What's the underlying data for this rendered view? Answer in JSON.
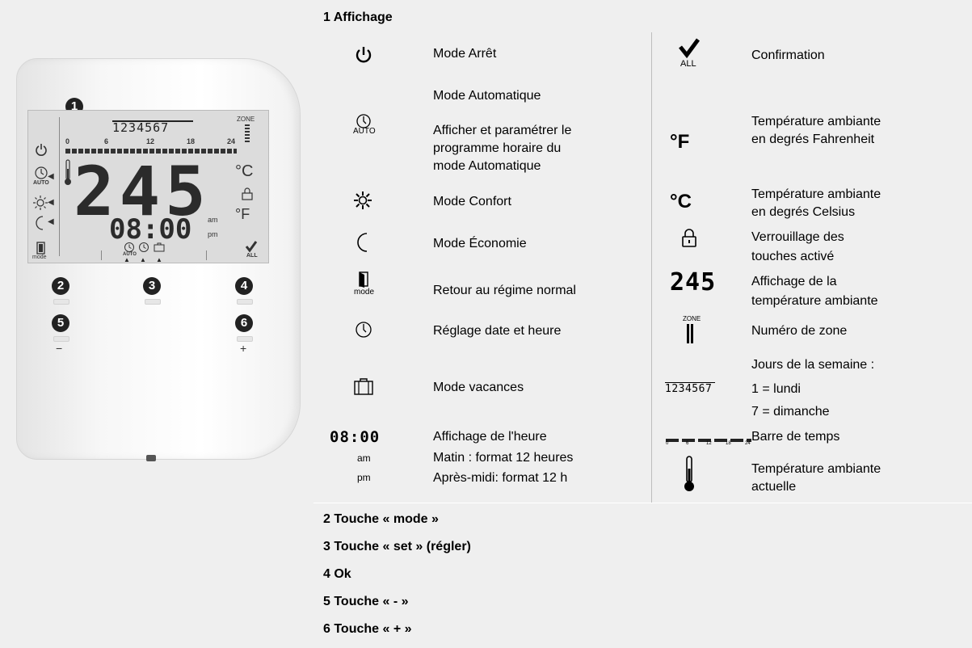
{
  "device": {
    "callouts": [
      "1",
      "2",
      "3",
      "4",
      "5",
      "6"
    ],
    "lcd": {
      "days": "1234567",
      "zone": "ZONE",
      "timescale": [
        "0",
        "6",
        "12",
        "18",
        "24"
      ],
      "temp": "245",
      "unit_c": "°C",
      "unit_f": "°F",
      "time": "08:00",
      "am": "am",
      "pm": "pm",
      "auto": "AUTO",
      "mode": "mode",
      "all": "ALL"
    },
    "minus": "−",
    "plus": "+"
  },
  "section1": {
    "title": "1  Affichage",
    "left_items": [
      {
        "icon": "power-icon",
        "text": [
          "Mode Arrêt"
        ]
      },
      {
        "icon": "clock-auto-icon",
        "text": [
          "Mode Automatique",
          "Afficher et paramétrer le",
          "programme horaire du",
          "mode Automatique"
        ],
        "icon_label": "AUTO"
      },
      {
        "icon": "sun-icon",
        "text": [
          "Mode Confort"
        ]
      },
      {
        "icon": "moon-icon",
        "text": [
          "Mode Économie"
        ]
      },
      {
        "icon": "door-mode-icon",
        "text": [
          "Retour au régime normal"
        ],
        "icon_label": "mode"
      },
      {
        "icon": "clock-icon",
        "text": [
          "Réglage date et heure"
        ]
      },
      {
        "icon": "suitcase-icon",
        "text": [
          "Mode vacances"
        ]
      },
      {
        "icon": "time-display-icon",
        "text": [
          "Affichage de l'heure",
          "Matin : format 12 heures",
          "Après-midi: format 12 h"
        ],
        "icon_label": "08:00",
        "am": "am",
        "pm": "pm"
      }
    ],
    "right_items": [
      {
        "icon": "checkmark-all-icon",
        "text": [
          "Confirmation"
        ],
        "icon_label": "ALL"
      },
      {
        "icon": "fahrenheit-icon",
        "text": [
          "Température ambiante",
          "en degrés Fahrenheit"
        ],
        "icon_label": "°F"
      },
      {
        "icon": "celsius-icon",
        "text": [
          "Température ambiante",
          "en degrés Celsius"
        ],
        "icon_label": "°C"
      },
      {
        "icon": "lock-icon",
        "text": [
          "Verrouillage des",
          "touches activé"
        ]
      },
      {
        "icon": "temperature-digits-icon",
        "text": [
          "Affichage de la",
          "température ambiante"
        ],
        "icon_label": "245"
      },
      {
        "icon": "zone-icon",
        "text": [
          "Numéro de zone"
        ],
        "icon_label": "ZONE"
      },
      {
        "icon": "weekdays-icon",
        "text": [
          "Jours de la semaine :",
          "1 = lundi",
          "7 = dimanche"
        ],
        "icon_label": "1234567"
      },
      {
        "icon": "timebar-icon",
        "text": [
          "Barre de temps"
        ],
        "icon_label": [
          "0",
          "6",
          "12",
          "18",
          "24"
        ]
      },
      {
        "icon": "thermometer-icon",
        "text": [
          "Température ambiante",
          "actuelle"
        ]
      }
    ]
  },
  "footer": [
    "2  Touche « mode »",
    "3  Touche « set »  (régler)",
    "4  Ok",
    "5  Touche « - »",
    "6  Touche « + »"
  ]
}
